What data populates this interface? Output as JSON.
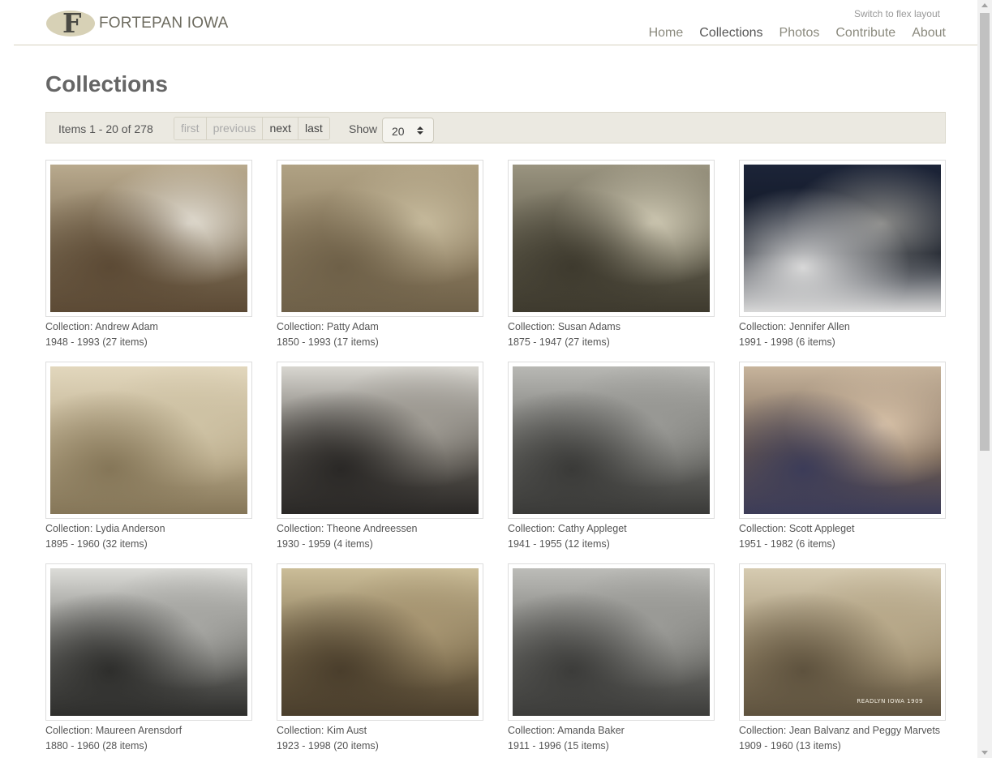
{
  "header": {
    "logo_letter": "F",
    "site_name": "FORTEPAN IOWA",
    "flex_switch": "Switch to flex layout",
    "nav": [
      {
        "label": "Home",
        "active": false
      },
      {
        "label": "Collections",
        "active": true
      },
      {
        "label": "Photos",
        "active": false
      },
      {
        "label": "Contribute",
        "active": false
      },
      {
        "label": "About",
        "active": false
      }
    ]
  },
  "page_title": "Collections",
  "pager": {
    "items_text": "Items 1 - 20 of 278",
    "first": "first",
    "previous": "previous",
    "next": "next",
    "last": "last",
    "show_label": "Show",
    "show_value": "20"
  },
  "collections": [
    {
      "title": "Collection: Andrew Adam",
      "dates": "1948 - 1993 (27 items)",
      "colors": [
        "#7a6a52",
        "#b9aa8e",
        "#5c4a35",
        "#e2ddd2"
      ]
    },
    {
      "title": "Collection: Patty Adam",
      "dates": "1850 - 1993 (17 items)",
      "colors": [
        "#8a7a5e",
        "#b0a284",
        "#6e6048",
        "#c8bc9e"
      ]
    },
    {
      "title": "Collection: Susan Adams",
      "dates": "1875 - 1947 (27 items)",
      "colors": [
        "#5e5a4a",
        "#9a9480",
        "#3e3a2e",
        "#d0cab4"
      ]
    },
    {
      "title": "Collection: Jennifer Allen",
      "dates": "1991 - 1998 (6 items)",
      "colors": [
        "#0e1420",
        "#1c2438",
        "#d8d8d8",
        "#8a8a88"
      ]
    },
    {
      "title": "Collection: Lydia Anderson",
      "dates": "1895 - 1960 (32 items)",
      "colors": [
        "#b7a888",
        "#e2d7bd",
        "#857658",
        "#cfc3a5"
      ]
    },
    {
      "title": "Collection: Theone Andreessen",
      "dates": "1930 - 1959 (4 items)",
      "colors": [
        "#5a5650",
        "#d8d6d0",
        "#2a2826",
        "#a09c94"
      ]
    },
    {
      "title": "Collection: Cathy Appleget",
      "dates": "1941 - 1955 (12 items)",
      "colors": [
        "#6a6a66",
        "#b8b8b4",
        "#3a3a38",
        "#9a9a96"
      ]
    },
    {
      "title": "Collection: Scott Appleget",
      "dates": "1951 - 1982 (6 items)",
      "colors": [
        "#6e5c4e",
        "#c7b49c",
        "#3c3c58",
        "#d8c2a8"
      ]
    },
    {
      "title": "Collection: Maureen Arensdorf",
      "dates": "1880 - 1960 (28 items)",
      "colors": [
        "#6a6a66",
        "#dcdcd8",
        "#2e2e2c",
        "#a8a8a4"
      ]
    },
    {
      "title": "Collection: Kim Aust",
      "dates": "1923 - 1998 (20 items)",
      "colors": [
        "#7a6a4c",
        "#cbbd98",
        "#4a3e2c",
        "#a89672"
      ]
    },
    {
      "title": "Collection: Amanda Baker",
      "dates": "1911 - 1996 (15 items)",
      "colors": [
        "#6c6c68",
        "#bcbcb8",
        "#3c3c3a",
        "#9c9c98"
      ]
    },
    {
      "title": "Collection: Jean Balvanz and Peggy Marvets",
      "dates": "1909 - 1960 (13 items)",
      "colors": [
        "#9a8a6c",
        "#d6cbb1",
        "#5e523e",
        "#b8a98a"
      ],
      "overlay_text": "READLYN IOWA 1909"
    }
  ]
}
